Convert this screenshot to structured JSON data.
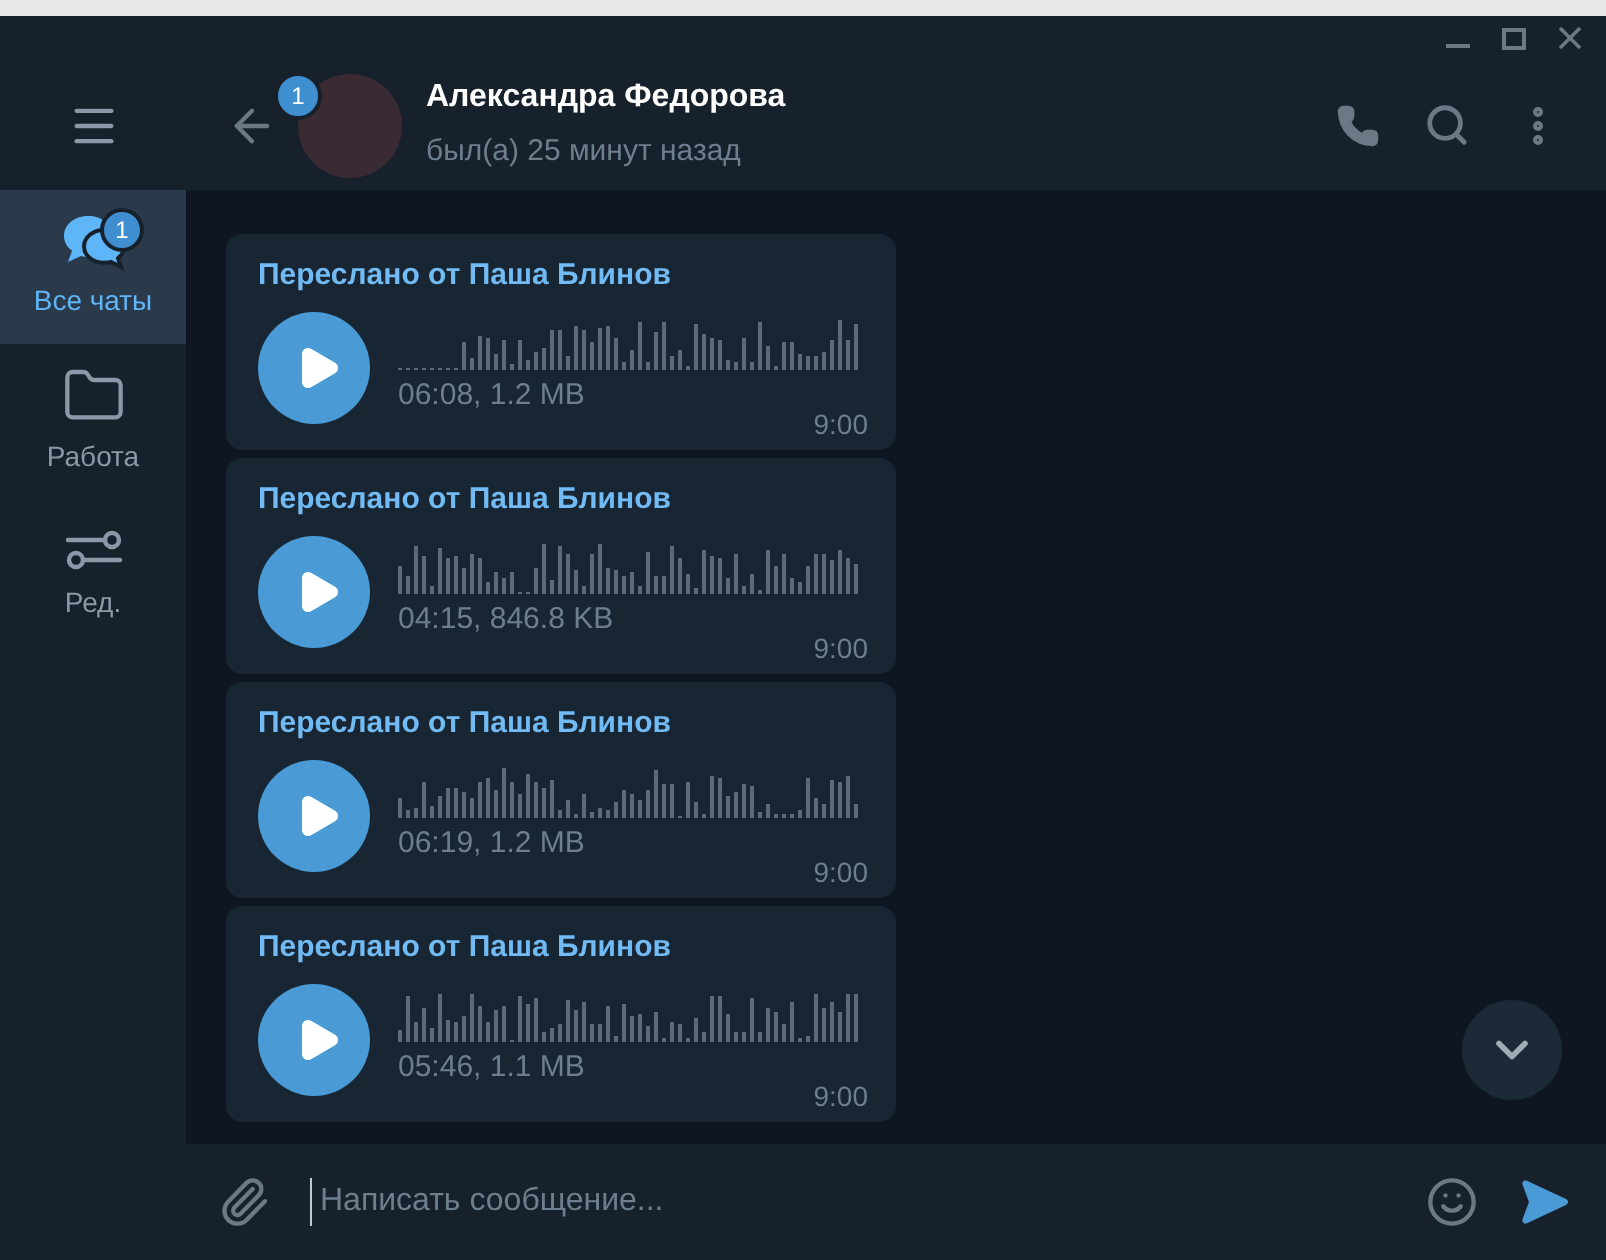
{
  "sidebar": {
    "items": [
      {
        "kind": "chats",
        "label": "Все чаты",
        "badge": "1",
        "selected": true
      },
      {
        "kind": "folder",
        "label": "Работа",
        "selected": false
      },
      {
        "kind": "edit",
        "label": "Ред.",
        "selected": false
      }
    ]
  },
  "header": {
    "badge": "1",
    "name": "Александра Федорова",
    "status": "был(а) 25 минут назад"
  },
  "messages": [
    {
      "forwarded": "Переслано от Паша Блинов",
      "meta": "06:08, 1.2 MB",
      "time": "9:00"
    },
    {
      "forwarded": "Переслано от Паша Блинов",
      "meta": "04:15, 846.8 KB",
      "time": "9:00"
    },
    {
      "forwarded": "Переслано от Паша Блинов",
      "meta": "06:19, 1.2 MB",
      "time": "9:00"
    },
    {
      "forwarded": "Переслано от Паша Блинов",
      "meta": "05:46, 1.1 MB",
      "time": "9:00"
    }
  ],
  "composer": {
    "placeholder": "Написать сообщение..."
  }
}
